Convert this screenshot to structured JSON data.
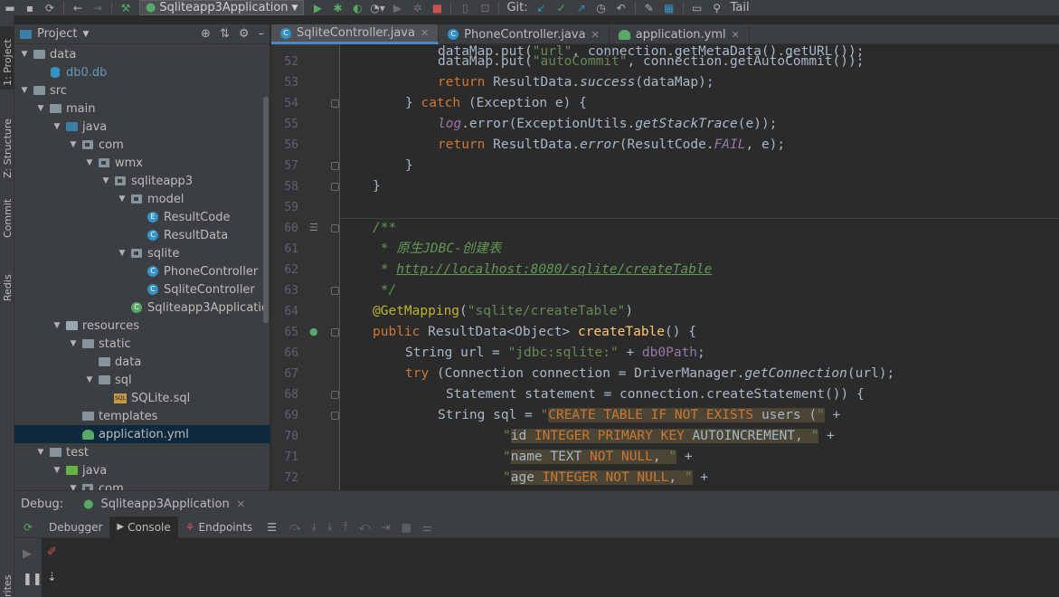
{
  "toolbar": {
    "run_config": "Sqliteapp3Application",
    "git_label": "Git:",
    "tail_label": "Tail"
  },
  "left_strip": {
    "tabs": [
      "1: Project",
      "Z: Structure",
      "Commit",
      "Redis",
      "rites"
    ]
  },
  "project": {
    "title": "Project",
    "tree": [
      {
        "label": "data",
        "indent": 1,
        "icon": "folder",
        "arrow": "down"
      },
      {
        "label": "db0.db",
        "indent": 2,
        "icon": "db",
        "arrow": "",
        "color": "#6897bb"
      },
      {
        "label": "src",
        "indent": 1,
        "icon": "folder",
        "arrow": "down"
      },
      {
        "label": "main",
        "indent": 2,
        "icon": "folder",
        "arrow": "down"
      },
      {
        "label": "java",
        "indent": 3,
        "icon": "src",
        "arrow": "down"
      },
      {
        "label": "com",
        "indent": 4,
        "icon": "pkg",
        "arrow": "down"
      },
      {
        "label": "wmx",
        "indent": 5,
        "icon": "pkg",
        "arrow": "down"
      },
      {
        "label": "sqliteapp3",
        "indent": 6,
        "icon": "pkg",
        "arrow": "down"
      },
      {
        "label": "model",
        "indent": 7,
        "icon": "pkg",
        "arrow": "down"
      },
      {
        "label": "ResultCode",
        "indent": 8,
        "icon": "enum",
        "arrow": ""
      },
      {
        "label": "ResultData",
        "indent": 8,
        "icon": "class",
        "arrow": ""
      },
      {
        "label": "sqlite",
        "indent": 7,
        "icon": "pkg",
        "arrow": "down"
      },
      {
        "label": "PhoneController",
        "indent": 8,
        "icon": "class",
        "arrow": ""
      },
      {
        "label": "SqliteController",
        "indent": 8,
        "icon": "class",
        "arrow": ""
      },
      {
        "label": "Sqliteapp3Applicatio",
        "indent": 7,
        "icon": "springclass",
        "arrow": ""
      },
      {
        "label": "resources",
        "indent": 3,
        "icon": "res",
        "arrow": "down"
      },
      {
        "label": "static",
        "indent": 4,
        "icon": "folder",
        "arrow": "down"
      },
      {
        "label": "data",
        "indent": 5,
        "icon": "folder",
        "arrow": ""
      },
      {
        "label": "sql",
        "indent": 5,
        "icon": "folder",
        "arrow": "down"
      },
      {
        "label": "SQLite.sql",
        "indent": 6,
        "icon": "sql",
        "arrow": ""
      },
      {
        "label": "templates",
        "indent": 4,
        "icon": "folder",
        "arrow": ""
      },
      {
        "label": "application.yml",
        "indent": 4,
        "icon": "yml",
        "arrow": "",
        "selected": true
      },
      {
        "label": "test",
        "indent": 2,
        "icon": "folder",
        "arrow": "down"
      },
      {
        "label": "java",
        "indent": 3,
        "icon": "test",
        "arrow": "down"
      },
      {
        "label": "com",
        "indent": 4,
        "icon": "pkg",
        "arrow": "down"
      }
    ]
  },
  "tabs": [
    {
      "label": "SqliteController.java",
      "icon": "class",
      "active": true
    },
    {
      "label": "PhoneController.java",
      "icon": "class",
      "active": false
    },
    {
      "label": "application.yml",
      "icon": "yml",
      "active": false
    }
  ],
  "editor": {
    "line_numbers": [
      "52",
      "53",
      "54",
      "55",
      "56",
      "57",
      "58",
      "59",
      "60",
      "61",
      "62",
      "63",
      "64",
      "65",
      "66",
      "67",
      "68",
      "69",
      "70",
      "71",
      "72"
    ]
  },
  "debug": {
    "title": "Debug:",
    "config": "Sqliteapp3Application",
    "tabs": [
      "Debugger",
      "Console",
      "Endpoints"
    ]
  }
}
